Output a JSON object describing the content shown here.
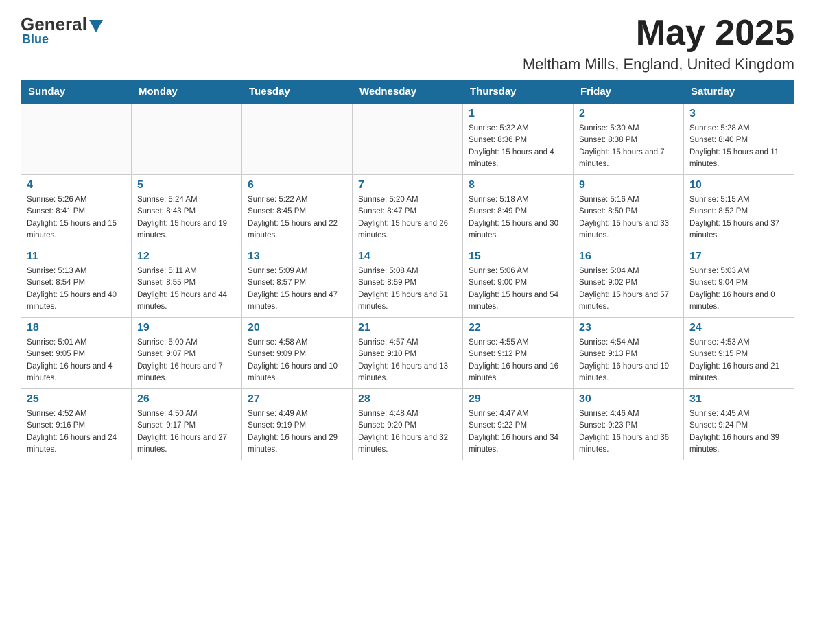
{
  "header": {
    "logo": {
      "general": "General",
      "blue": "Blue"
    },
    "title": "May 2025",
    "location": "Meltham Mills, England, United Kingdom"
  },
  "days_of_week": [
    "Sunday",
    "Monday",
    "Tuesday",
    "Wednesday",
    "Thursday",
    "Friday",
    "Saturday"
  ],
  "weeks": [
    [
      {
        "day": "",
        "info": ""
      },
      {
        "day": "",
        "info": ""
      },
      {
        "day": "",
        "info": ""
      },
      {
        "day": "",
        "info": ""
      },
      {
        "day": "1",
        "info": "Sunrise: 5:32 AM\nSunset: 8:36 PM\nDaylight: 15 hours and 4 minutes."
      },
      {
        "day": "2",
        "info": "Sunrise: 5:30 AM\nSunset: 8:38 PM\nDaylight: 15 hours and 7 minutes."
      },
      {
        "day": "3",
        "info": "Sunrise: 5:28 AM\nSunset: 8:40 PM\nDaylight: 15 hours and 11 minutes."
      }
    ],
    [
      {
        "day": "4",
        "info": "Sunrise: 5:26 AM\nSunset: 8:41 PM\nDaylight: 15 hours and 15 minutes."
      },
      {
        "day": "5",
        "info": "Sunrise: 5:24 AM\nSunset: 8:43 PM\nDaylight: 15 hours and 19 minutes."
      },
      {
        "day": "6",
        "info": "Sunrise: 5:22 AM\nSunset: 8:45 PM\nDaylight: 15 hours and 22 minutes."
      },
      {
        "day": "7",
        "info": "Sunrise: 5:20 AM\nSunset: 8:47 PM\nDaylight: 15 hours and 26 minutes."
      },
      {
        "day": "8",
        "info": "Sunrise: 5:18 AM\nSunset: 8:49 PM\nDaylight: 15 hours and 30 minutes."
      },
      {
        "day": "9",
        "info": "Sunrise: 5:16 AM\nSunset: 8:50 PM\nDaylight: 15 hours and 33 minutes."
      },
      {
        "day": "10",
        "info": "Sunrise: 5:15 AM\nSunset: 8:52 PM\nDaylight: 15 hours and 37 minutes."
      }
    ],
    [
      {
        "day": "11",
        "info": "Sunrise: 5:13 AM\nSunset: 8:54 PM\nDaylight: 15 hours and 40 minutes."
      },
      {
        "day": "12",
        "info": "Sunrise: 5:11 AM\nSunset: 8:55 PM\nDaylight: 15 hours and 44 minutes."
      },
      {
        "day": "13",
        "info": "Sunrise: 5:09 AM\nSunset: 8:57 PM\nDaylight: 15 hours and 47 minutes."
      },
      {
        "day": "14",
        "info": "Sunrise: 5:08 AM\nSunset: 8:59 PM\nDaylight: 15 hours and 51 minutes."
      },
      {
        "day": "15",
        "info": "Sunrise: 5:06 AM\nSunset: 9:00 PM\nDaylight: 15 hours and 54 minutes."
      },
      {
        "day": "16",
        "info": "Sunrise: 5:04 AM\nSunset: 9:02 PM\nDaylight: 15 hours and 57 minutes."
      },
      {
        "day": "17",
        "info": "Sunrise: 5:03 AM\nSunset: 9:04 PM\nDaylight: 16 hours and 0 minutes."
      }
    ],
    [
      {
        "day": "18",
        "info": "Sunrise: 5:01 AM\nSunset: 9:05 PM\nDaylight: 16 hours and 4 minutes."
      },
      {
        "day": "19",
        "info": "Sunrise: 5:00 AM\nSunset: 9:07 PM\nDaylight: 16 hours and 7 minutes."
      },
      {
        "day": "20",
        "info": "Sunrise: 4:58 AM\nSunset: 9:09 PM\nDaylight: 16 hours and 10 minutes."
      },
      {
        "day": "21",
        "info": "Sunrise: 4:57 AM\nSunset: 9:10 PM\nDaylight: 16 hours and 13 minutes."
      },
      {
        "day": "22",
        "info": "Sunrise: 4:55 AM\nSunset: 9:12 PM\nDaylight: 16 hours and 16 minutes."
      },
      {
        "day": "23",
        "info": "Sunrise: 4:54 AM\nSunset: 9:13 PM\nDaylight: 16 hours and 19 minutes."
      },
      {
        "day": "24",
        "info": "Sunrise: 4:53 AM\nSunset: 9:15 PM\nDaylight: 16 hours and 21 minutes."
      }
    ],
    [
      {
        "day": "25",
        "info": "Sunrise: 4:52 AM\nSunset: 9:16 PM\nDaylight: 16 hours and 24 minutes."
      },
      {
        "day": "26",
        "info": "Sunrise: 4:50 AM\nSunset: 9:17 PM\nDaylight: 16 hours and 27 minutes."
      },
      {
        "day": "27",
        "info": "Sunrise: 4:49 AM\nSunset: 9:19 PM\nDaylight: 16 hours and 29 minutes."
      },
      {
        "day": "28",
        "info": "Sunrise: 4:48 AM\nSunset: 9:20 PM\nDaylight: 16 hours and 32 minutes."
      },
      {
        "day": "29",
        "info": "Sunrise: 4:47 AM\nSunset: 9:22 PM\nDaylight: 16 hours and 34 minutes."
      },
      {
        "day": "30",
        "info": "Sunrise: 4:46 AM\nSunset: 9:23 PM\nDaylight: 16 hours and 36 minutes."
      },
      {
        "day": "31",
        "info": "Sunrise: 4:45 AM\nSunset: 9:24 PM\nDaylight: 16 hours and 39 minutes."
      }
    ]
  ]
}
